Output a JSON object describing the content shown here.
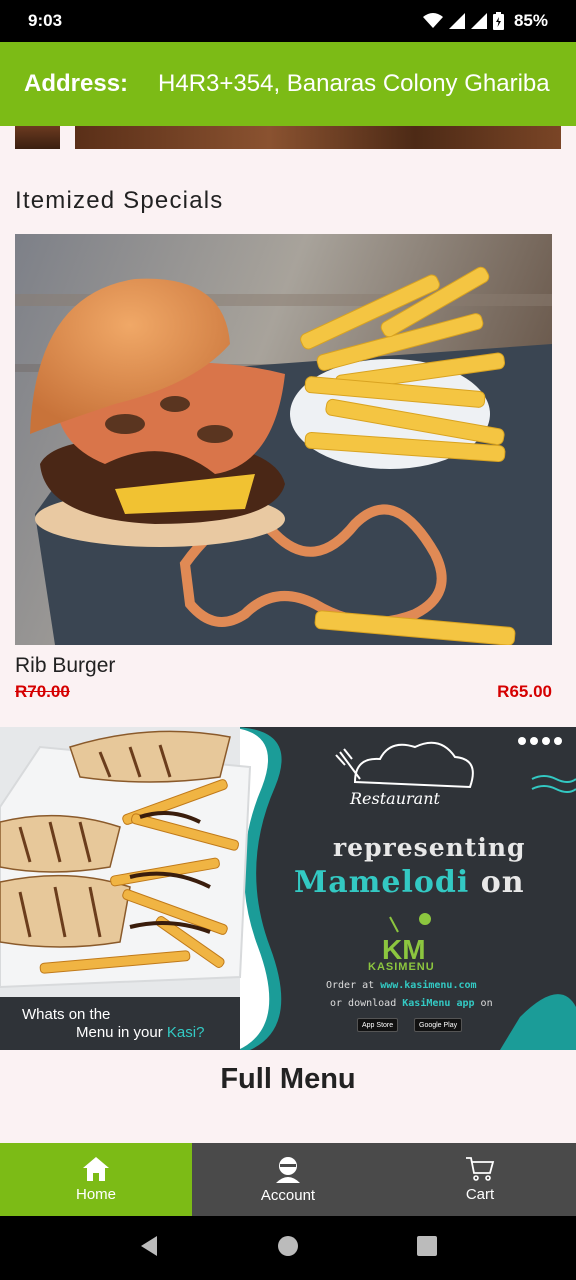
{
  "status_bar": {
    "time": "9:03",
    "battery": "85%",
    "icons": [
      "wifi-icon",
      "signal-icon",
      "signal-icon",
      "battery-icon"
    ]
  },
  "address": {
    "label": "Address:",
    "value": "H4R3+354, Banaras Colony Ghariba"
  },
  "section_title": "Itemized Specials",
  "item": {
    "name": "Rib Burger",
    "old_price": "R70.00",
    "new_price": "R65.00",
    "image": "burger-and-fries-photo"
  },
  "banner": {
    "restaurant_name": "Restaurant",
    "representing": "representing",
    "mamelodi": "Mamelodi",
    "on": "on",
    "km": "KM",
    "kasimenu": "KASIMENU",
    "order_prefix": "Order at",
    "order_url": "www.kasimenu.com",
    "download_prefix": "or download",
    "download_app": "KasiMenu app",
    "download_suffix": "on",
    "app_store": "App Store",
    "google_play": "Google Play",
    "whats": "Whats",
    "on_the": "on the",
    "menu": "Menu",
    "in_your": "in your",
    "kasi": "Kasi?"
  },
  "full_menu_title": "Full Menu",
  "bottom_nav": [
    {
      "label": "Home",
      "icon": "home-icon",
      "active": true
    },
    {
      "label": "Account",
      "icon": "account-icon",
      "active": false
    },
    {
      "label": "Cart",
      "icon": "cart-icon",
      "active": false
    }
  ],
  "system_nav": [
    "back-icon",
    "home-circle-icon",
    "recents-icon"
  ],
  "colors": {
    "accent_green": "#7cbb16",
    "price_red": "#d50000",
    "nav_gray": "#4a4a4a",
    "teal": "#33c9c3"
  }
}
